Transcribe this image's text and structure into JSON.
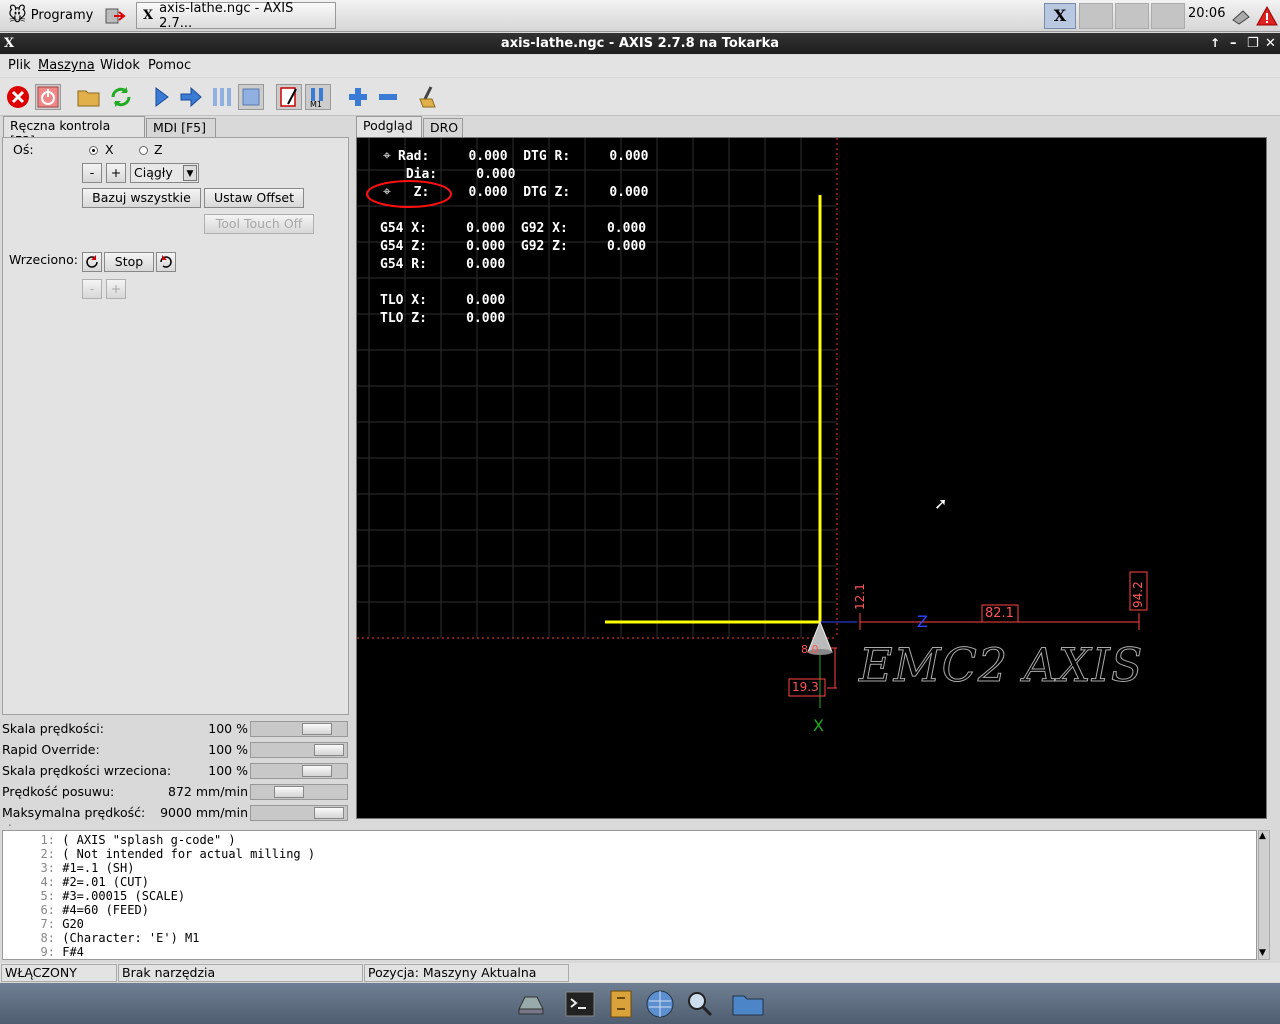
{
  "taskbar": {
    "start_label": "Programy",
    "window_button_label": "axis-lathe.ngc - AXIS 2.7...",
    "clock": "20:06"
  },
  "window": {
    "title": "axis-lathe.ngc - AXIS 2.7.8 na Tokarka"
  },
  "menu": {
    "items": [
      "Plik",
      "Maszyna",
      "Widok",
      "Pomoc"
    ]
  },
  "toolbar": {
    "icons": [
      "estop-icon",
      "power-icon",
      "open-file-icon",
      "reload-icon",
      "run-icon",
      "step-icon",
      "pause-icon",
      "stop-icon",
      "block-delete-icon",
      "optional-stop-icon",
      "zoom-in-icon",
      "zoom-out-icon",
      "clear-plot-icon"
    ]
  },
  "left_tabs": [
    "Ręczna kontrola [F3]",
    "MDI [F5]"
  ],
  "manual": {
    "axis_label": "Oś:",
    "axis_x": "X",
    "axis_z": "Z",
    "minus": "-",
    "plus": "+",
    "jog_mode": "Ciągły",
    "home_all": "Bazuj wszystkie",
    "set_offset": "Ustaw Offset",
    "tool_touch_off": "Tool Touch Off",
    "spindle_label": "Wrzeciono:",
    "spindle_stop": "Stop"
  },
  "sliders": [
    {
      "label": "Skala prędkości:",
      "value": "100 %",
      "fraction": 0.8
    },
    {
      "label": "Rapid Override:",
      "value": "100 %",
      "fraction": 1.0
    },
    {
      "label": "Skala prędkości wrzeciona:",
      "value": "100 %",
      "fraction": 0.8
    },
    {
      "label": "Prędkość posuwu:",
      "value": "872 mm/min",
      "fraction": 0.35
    },
    {
      "label": "Maksymalna prędkość:",
      "value": "9000 mm/min",
      "fraction": 1.0
    }
  ],
  "right_tabs": [
    "Podgląd",
    "DRO"
  ],
  "dro": {
    "row1": "Rad:     0.000  DTG R:     0.000",
    "row2": " Dia:     0.000",
    "row3": "  Z:     0.000  DTG Z:     0.000",
    "row4": "G54 X:     0.000  G92 X:     0.000",
    "row5": "G54 Z:     0.000  G92 Z:     0.000",
    "row6": "G54 R:     0.000",
    "row7": "TLO X:     0.000",
    "row8": "TLO Z:     0.000"
  },
  "plot": {
    "dim_z": "82.1",
    "dim_x_top": "12.1",
    "dim_right": "94.2",
    "dim_small": "8.0",
    "dim_bottom": "19.3",
    "axis_z_label": "Z",
    "axis_x_label": "X",
    "logo": "EMC2 AXIS"
  },
  "gcode": [
    {
      "n": "1:",
      "t": "( AXIS \"splash g-code\" )"
    },
    {
      "n": "2:",
      "t": "( Not intended for actual milling )"
    },
    {
      "n": "3:",
      "t": "#1=.1 (SH)"
    },
    {
      "n": "4:",
      "t": "#2=.01 (CUT)"
    },
    {
      "n": "5:",
      "t": "#3=.00015 (SCALE)"
    },
    {
      "n": "6:",
      "t": "#4=60 (FEED)"
    },
    {
      "n": "7:",
      "t": "G20"
    },
    {
      "n": "8:",
      "t": "(Character: 'E') M1"
    },
    {
      "n": "9:",
      "t": "F#4"
    }
  ],
  "status": {
    "state": "WŁĄCZONY",
    "tool": "Brak narzędzia",
    "position": "Pozycja: Maszyny Aktualna"
  },
  "colors": {
    "toolpath": "#ffff00",
    "limit": "#ff3333",
    "grid": "#303030"
  }
}
